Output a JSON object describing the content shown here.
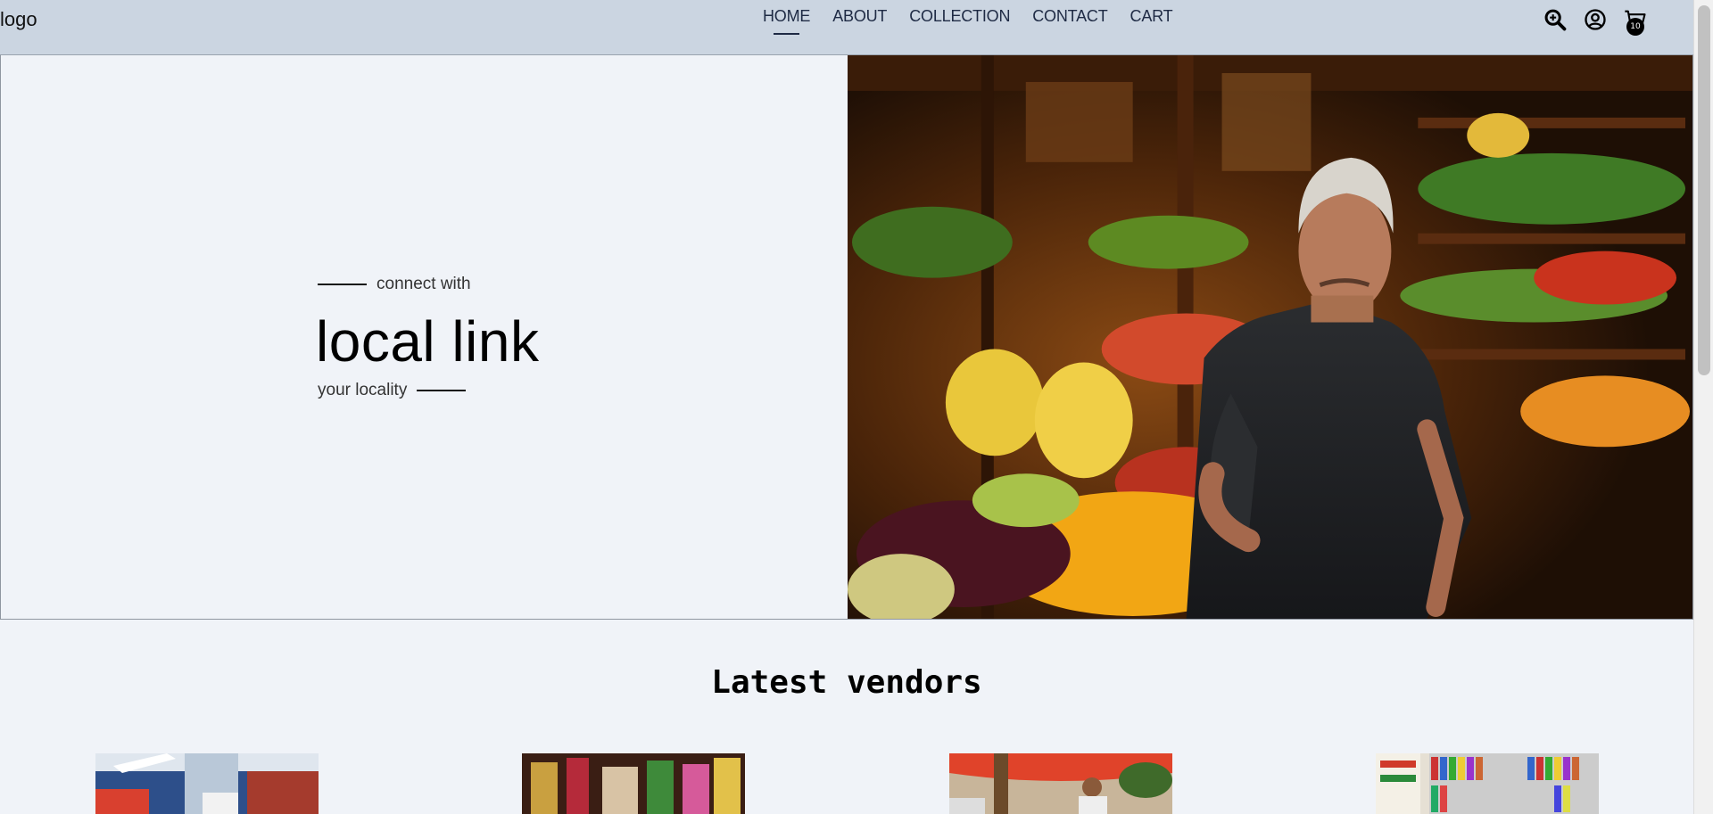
{
  "header": {
    "logo": "logo",
    "nav": [
      {
        "label": "HOME",
        "active": true
      },
      {
        "label": "ABOUT",
        "active": false
      },
      {
        "label": "COLLECTION",
        "active": false
      },
      {
        "label": "CONTACT",
        "active": false
      },
      {
        "label": "CART",
        "active": false
      }
    ],
    "icons": [
      "search-icon",
      "user-icon",
      "cart-icon"
    ],
    "cart_count": "10"
  },
  "hero": {
    "tagline_top": "connect with",
    "title": "local link",
    "tagline_bottom": "your locality",
    "image": "market-vendor-photo"
  },
  "vendors": {
    "title": "Latest vendors",
    "cards": [
      {
        "image": "supermarket-photo"
      },
      {
        "image": "market-stall-photo"
      },
      {
        "image": "street-vendor-umbrella-photo"
      },
      {
        "image": "bookshop-photo"
      }
    ]
  },
  "colors": {
    "header_bg": "#cbd5e1",
    "page_bg": "#f0f3f8",
    "nav_text": "#1e2a44"
  }
}
